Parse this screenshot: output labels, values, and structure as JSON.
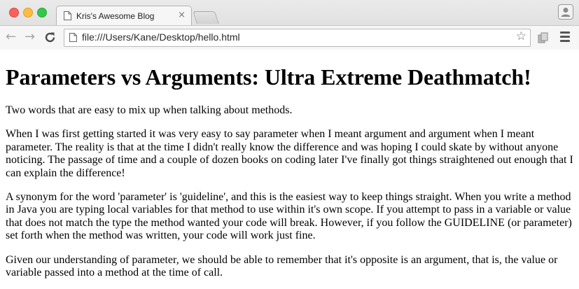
{
  "browser": {
    "tab": {
      "title": "Kris's Awesome Blog",
      "close_glyph": "×"
    },
    "toolbar": {
      "back_glyph": "←",
      "forward_glyph": "→",
      "reload_glyph": "C",
      "url": "file:///Users/Kane/Desktop/hello.html",
      "bookmark_glyph": "☆"
    }
  },
  "page": {
    "heading": "Parameters vs Arguments: Ultra Extreme Deathmatch!",
    "paragraphs": [
      "Two words that are easy to mix up when talking about methods.",
      "When I was first getting started it was very easy to say parameter when I meant argument and argument when I meant parameter. The reality is that at the time I didn't really know the difference and was hoping I could skate by without anyone noticing. The passage of time and a couple of dozen books on coding later I've finally got things straightened out enough that I can explain the difference!",
      "A synonym for the word 'parameter' is 'guideline', and this is the easiest way to keep things straight. When you write a method in Java you are typing local variables for that method to use within it's own scope. If you attempt to pass in a variable or value that does not match the type the method wanted your code will break. However, if you follow the GUIDELINE (or parameter) set forth when the method was written, your code will work just fine.",
      "Given our understanding of parameter, we should be able to remember that it's opposite is an argument, that is, the value or variable passed into a method at the time of call."
    ]
  },
  "icons": {
    "window_close": "close-window-icon",
    "window_minimize": "minimize-window-icon",
    "window_maximize": "maximize-window-icon",
    "tab_page": "page-icon",
    "profile": "profile-icon",
    "extension": "extension-icon",
    "menu": "hamburger-menu-icon"
  },
  "colors": {
    "close": "#fc605c",
    "minimize": "#fdbc40",
    "maximize": "#34c84a"
  }
}
